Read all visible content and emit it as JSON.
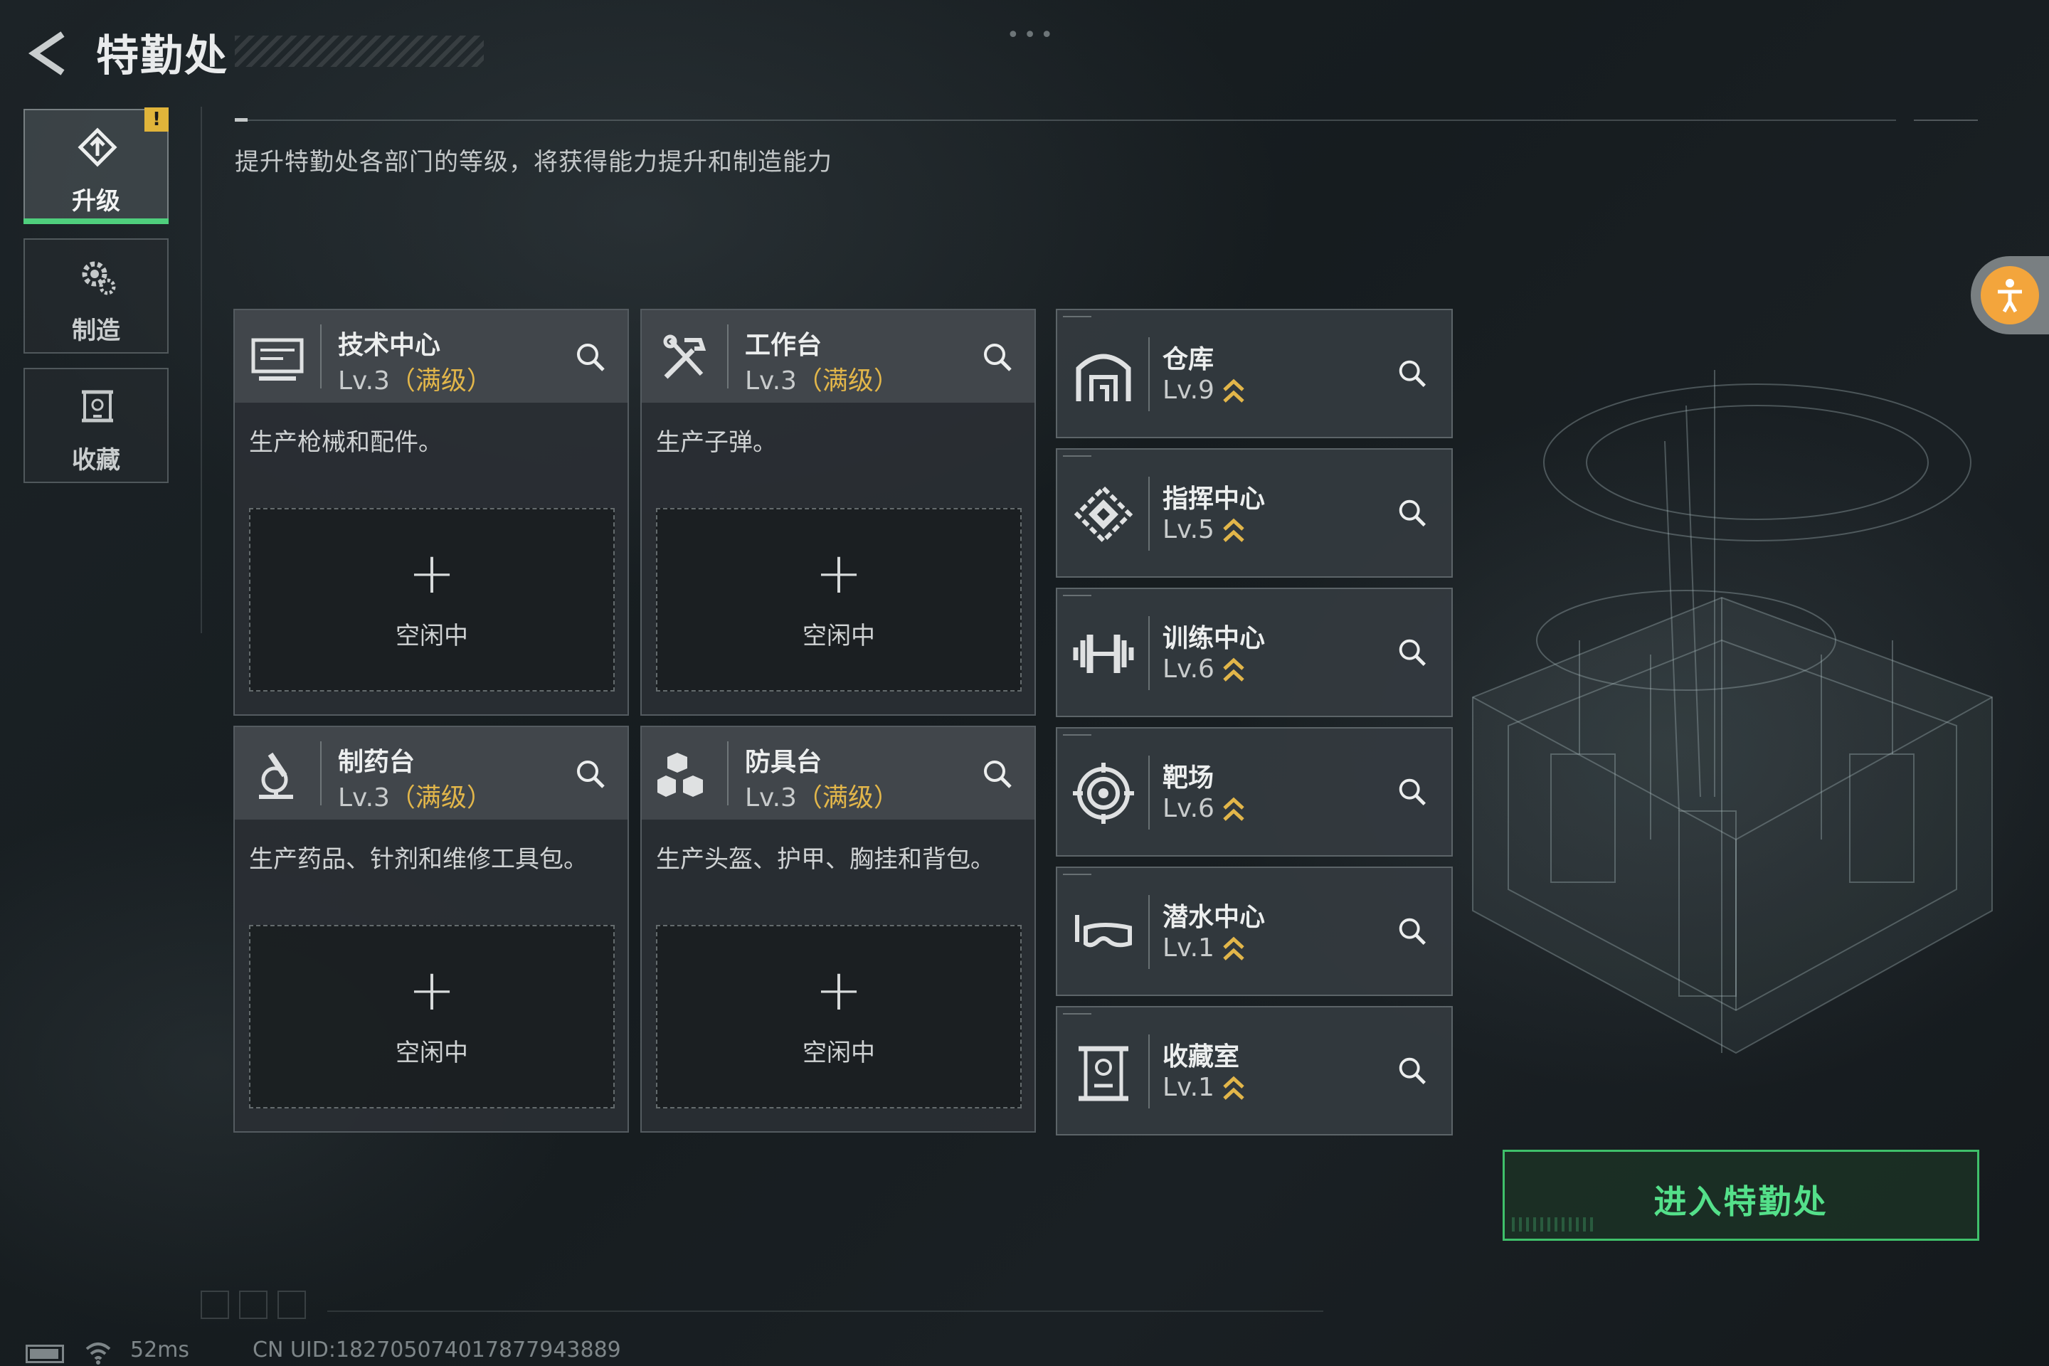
{
  "header": {
    "title": "特勤处"
  },
  "sidebar": {
    "items": [
      {
        "label": "升级",
        "icon": "upgrade-icon",
        "badge": "!"
      },
      {
        "label": "制造",
        "icon": "gear-icon"
      },
      {
        "label": "收藏",
        "icon": "collection-icon"
      }
    ]
  },
  "main": {
    "description": "提升特勤处各部门的等级，将获得能力提升和制造能力",
    "workstations": [
      {
        "name": "技术中心",
        "level": "Lv.3",
        "max": "（满级）",
        "desc": "生产枪械和配件。",
        "plus": "+",
        "idle": "空闲中",
        "icon": "computer-icon"
      },
      {
        "name": "工作台",
        "level": "Lv.3",
        "max": "（满级）",
        "desc": "生产子弹。",
        "plus": "+",
        "idle": "空闲中",
        "icon": "tools-icon"
      },
      {
        "name": "制药台",
        "level": "Lv.3",
        "max": "（满级）",
        "desc": "生产药品、针剂和维修工具包。",
        "plus": "+",
        "idle": "空闲中",
        "icon": "microscope-icon"
      },
      {
        "name": "防具台",
        "level": "Lv.3",
        "max": "（满级）",
        "desc": "生产头盔、护甲、胸挂和背包。",
        "plus": "+",
        "idle": "空闲中",
        "icon": "armor-icon"
      }
    ],
    "facilities": [
      {
        "name": "仓库",
        "level": "Lv.9",
        "icon": "warehouse-icon"
      },
      {
        "name": "指挥中心",
        "level": "Lv.5",
        "icon": "command-icon"
      },
      {
        "name": "训练中心",
        "level": "Lv.6",
        "icon": "dumbbell-icon"
      },
      {
        "name": "靶场",
        "level": "Lv.6",
        "icon": "target-icon"
      },
      {
        "name": "潜水中心",
        "level": "Lv.1",
        "icon": "diving-mask-icon"
      },
      {
        "name": "收藏室",
        "level": "Lv.1",
        "icon": "collection-room-icon"
      }
    ],
    "enter_button": "进入特勤处"
  },
  "status_bar": {
    "ping": "52ms",
    "uid": "CN UID:182705074017877943889"
  },
  "colors": {
    "accent_green": "#4fcf7d",
    "max_level_gold": "#e2b64a",
    "badge_yellow": "#e0b43a",
    "float_orange": "#f3a53c"
  }
}
